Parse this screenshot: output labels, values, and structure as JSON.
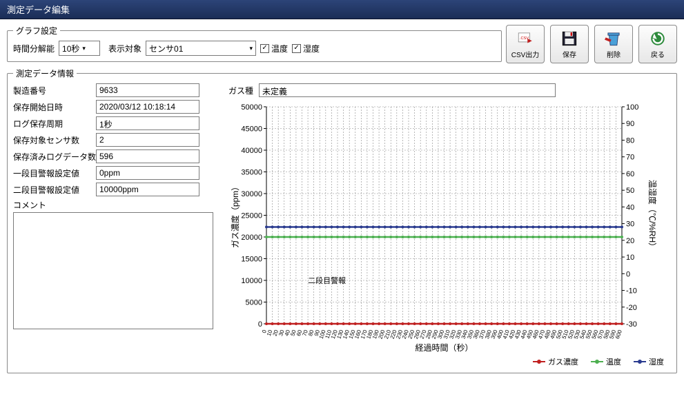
{
  "title": "測定データ編集",
  "graph_settings": {
    "legend": "グラフ設定",
    "time_res_label": "時間分解能",
    "time_res_value": "10秒",
    "target_label": "表示対象",
    "target_value": "センサ01",
    "cb_temp_label": "温度",
    "cb_temp_checked": true,
    "cb_humid_label": "湿度",
    "cb_humid_checked": true
  },
  "toolbar": {
    "csv": "CSV出力",
    "save": "保存",
    "delete": "削除",
    "back": "戻る"
  },
  "info": {
    "legend": "測定データ情報",
    "serial_label": "製造番号",
    "serial_value": "9633",
    "start_label": "保存開始日時",
    "start_value": "2020/03/12 10:18:14",
    "period_label": "ログ保存周期",
    "period_value": "1秒",
    "sensors_label": "保存対象センサ数",
    "sensors_value": "2",
    "logcount_label": "保存済みログデータ数",
    "logcount_value": "596",
    "alarm1_label": "一段目警報設定値",
    "alarm1_value": "0ppm",
    "alarm2_label": "二段目警報設定値",
    "alarm2_value": "10000ppm",
    "comment_label": "コメント",
    "gas_label": "ガス種",
    "gas_value": "未定義"
  },
  "chart_data": {
    "type": "line",
    "x_range": [
      0,
      600
    ],
    "x_step": 10,
    "y_left_range": [
      0,
      50000
    ],
    "y_left_step": 5000,
    "y_right_range": [
      -30,
      100
    ],
    "y_right_step": 10,
    "y_left_label": "ガス濃度（ppm）",
    "y_right_label": "温湿度（℃/%RH）",
    "x_label": "経過時間（秒）",
    "series": [
      {
        "name": "ガス濃度",
        "axis": "left",
        "color": "#c02020",
        "flat_value": 0
      },
      {
        "name": "温度",
        "axis": "right",
        "color": "#4caf50",
        "flat_value": 22
      },
      {
        "name": "湿度",
        "axis": "right",
        "color": "#2a3b8f",
        "flat_value": 28
      }
    ],
    "annotation": {
      "text": "二段目警報",
      "x": 70,
      "y_left": 10000
    },
    "colors": {
      "grid": "#888",
      "axis": "#000"
    }
  },
  "legend": {
    "gas": "ガス濃度",
    "temp": "温度",
    "humid": "湿度"
  }
}
